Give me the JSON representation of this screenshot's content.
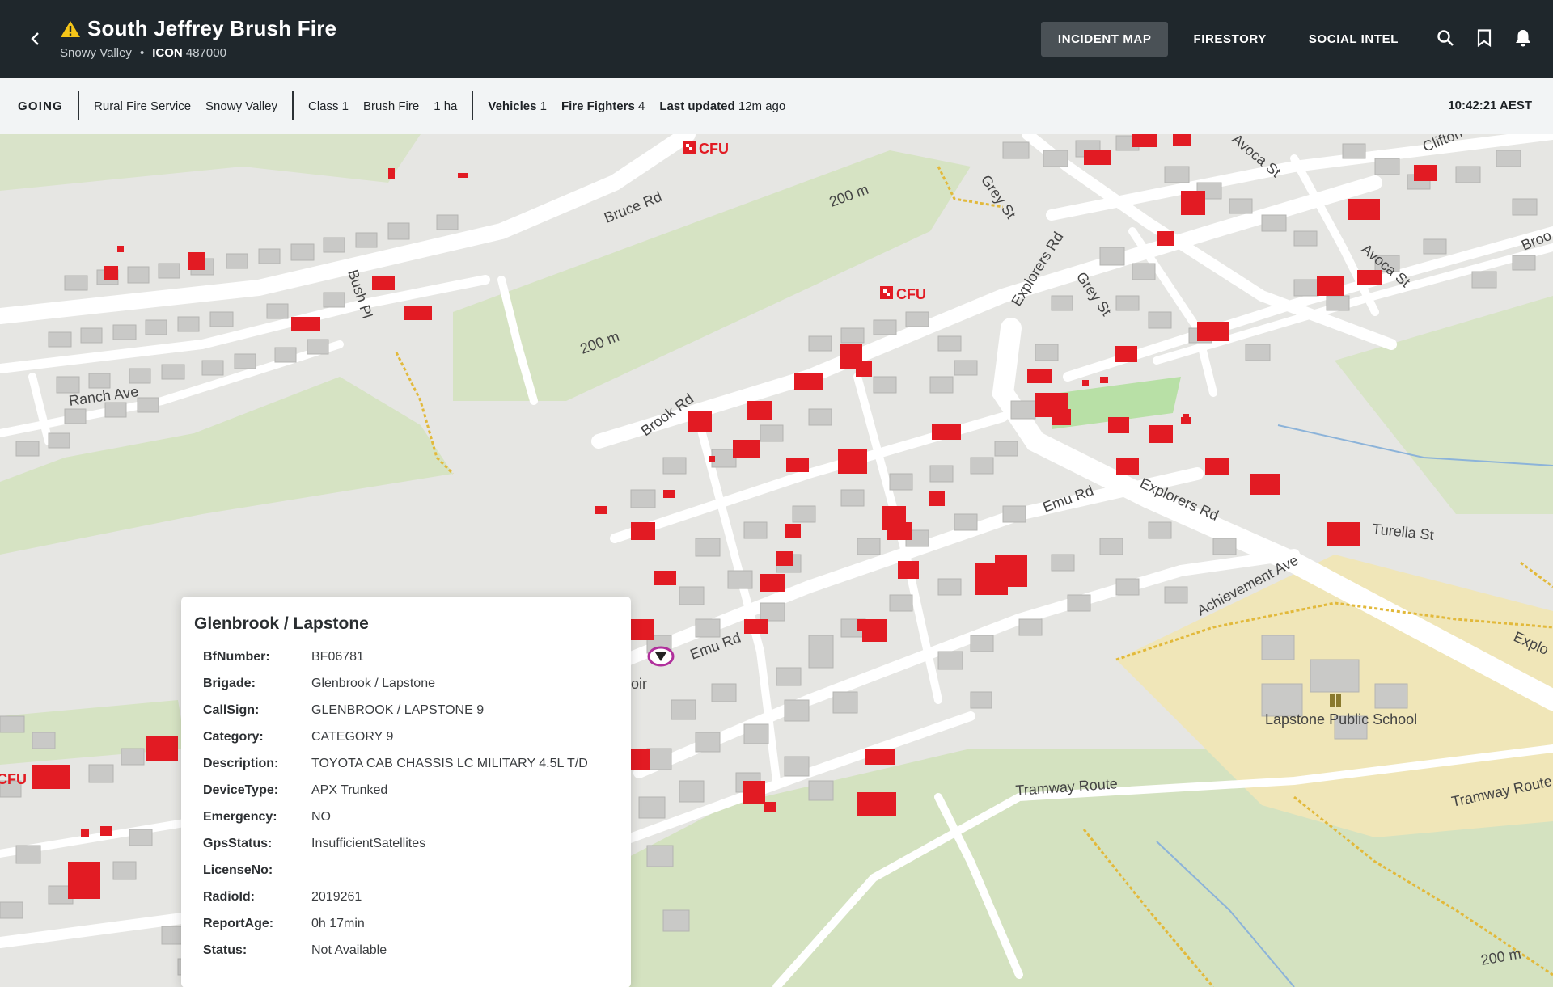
{
  "header": {
    "title": "South Jeffrey Brush Fire",
    "location": "Snowy Valley",
    "icon_label": "ICON",
    "icon_number": "487000",
    "tabs": [
      {
        "label": "INCIDENT MAP",
        "active": true
      },
      {
        "label": "FIRESTORY",
        "active": false
      },
      {
        "label": "SOCIAL INTEL",
        "active": false
      }
    ],
    "icons": [
      "search-icon",
      "bookmark-icon",
      "bell-icon"
    ],
    "warning_color": "#f5c518"
  },
  "status": {
    "state": "GOING",
    "service": "Rural Fire Service",
    "region": "Snowy Valley",
    "class": "Class 1",
    "type": "Brush Fire",
    "area": "1 ha",
    "vehicles_label": "Vehicles",
    "vehicles": "1",
    "firefighters_label": "Fire Fighters",
    "firefighters": "4",
    "updated_label": "Last updated",
    "updated": "12m ago",
    "time": "10:42:21 AEST"
  },
  "map": {
    "labels": {
      "bruce_rd": "Bruce Rd",
      "bush_pl": "Bush Pl",
      "ranch_ave": "Ranch Ave",
      "brook_rd": "Brook Rd",
      "grey_st_1": "Grey St",
      "grey_st_2": "Grey St",
      "explorers_rd_1": "Explorers Rd",
      "explorers_rd_2": "Explorers Rd",
      "explorers_rd_3": "Explo",
      "avoca_st_1": "Avoca St",
      "avoca_st_2": "Avoca St",
      "clifton": "Clifton",
      "broo": "Broo",
      "emu_rd_1": "Emu Rd",
      "emu_rd_2": "Emu Rd",
      "turella_st": "Turella St",
      "achievement_ave": "Achievement Ave",
      "tramway_route_1": "Tramway Route",
      "tramway_route_2": "Tramway Route",
      "school": "Lapstone Public School",
      "contour_1": "200 m",
      "contour_2": "200 m",
      "contour_3": "200 m",
      "voir": "oir",
      "cfu_1": "CFU",
      "cfu_2": "CFU",
      "cfu_3": "CFU"
    },
    "colors": {
      "background": "#e6e6e3",
      "green": "#d6e3c3",
      "school": "#f0e6b8",
      "road": "#ffffff",
      "building": "#c9c9c7",
      "burning": "#e21b23",
      "track": "#e2b93b"
    }
  },
  "popup": {
    "title": "Glenbrook / Lapstone",
    "rows": [
      {
        "key": "BfNumber:",
        "value": "BF06781"
      },
      {
        "key": "Brigade:",
        "value": "Glenbrook / Lapstone"
      },
      {
        "key": "CallSign:",
        "value": "GLENBROOK / LAPSTONE 9"
      },
      {
        "key": "Category:",
        "value": "CATEGORY 9"
      },
      {
        "key": "Description:",
        "value": "TOYOTA CAB CHASSIS LC MILITARY 4.5L T/D"
      },
      {
        "key": "DeviceType:",
        "value": "APX Trunked"
      },
      {
        "key": "Emergency:",
        "value": "NO"
      },
      {
        "key": "GpsStatus:",
        "value": "InsufficientSatellites"
      },
      {
        "key": "LicenseNo:",
        "value": ""
      },
      {
        "key": "RadioId:",
        "value": "2019261"
      },
      {
        "key": "ReportAge:",
        "value": "0h 17min"
      },
      {
        "key": "Status:",
        "value": "Not Available"
      }
    ]
  }
}
